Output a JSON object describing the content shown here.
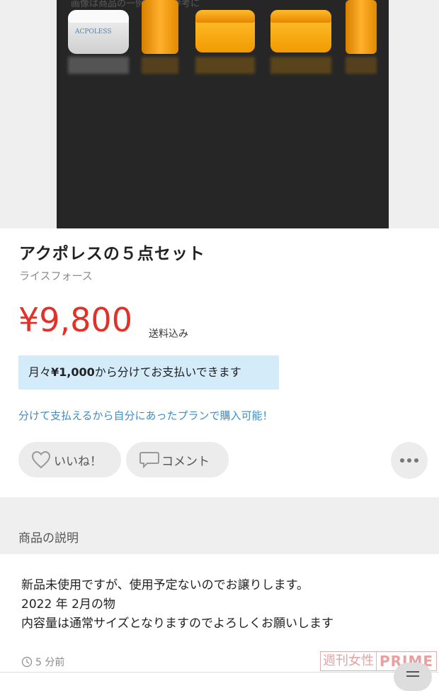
{
  "hero": {
    "caption": "画像は商品の一例です／参考に"
  },
  "product": {
    "title": "アクポレスの５点セット",
    "brand": "ライスフォース",
    "price": "¥9,800",
    "shipping": "送料込み"
  },
  "installment": {
    "prefix": "月々",
    "amount": "¥1,000",
    "suffix": "から分けてお支払いできます"
  },
  "plan_link": "分けて支払えるから自分にあったプランで購入可能！",
  "actions": {
    "like_label": "いいね！",
    "comment_label": "コメント",
    "more_icon": "more-horizontal-icon"
  },
  "description": {
    "section_title": "商品の説明",
    "lines": [
      "新品未使用ですが、使用予定ないのでお譲りします。",
      "2022 年 2月の物",
      "内容量は通常サイズとなりますのでよろしくお願いします"
    ]
  },
  "posted": "5 分前",
  "watermark": {
    "left": "週刊女性",
    "right": "PRIME"
  },
  "colors": {
    "price": "#e03228",
    "link": "#3d8ec9",
    "installment_bg": "#d4ebf9"
  }
}
